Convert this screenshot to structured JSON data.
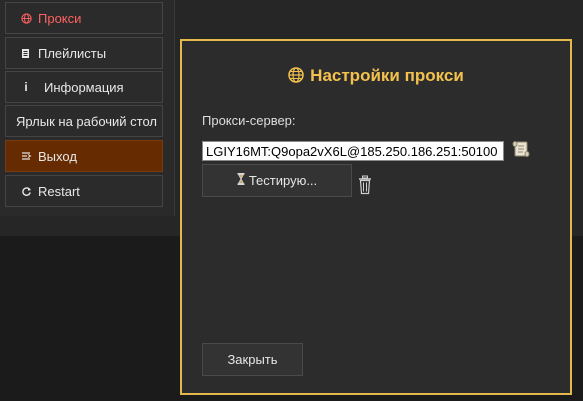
{
  "sidebar": {
    "items": [
      {
        "icon": "globe-icon",
        "label": "Прокси",
        "state": "active"
      },
      {
        "icon": "playlist-icon",
        "label": "Плейлисты"
      },
      {
        "icon": "info-icon",
        "label": "Информация"
      },
      {
        "icon": "",
        "label": "Ярлык на рабочий стол"
      },
      {
        "icon": "exit-icon",
        "label": "Выход",
        "state": "highlighted"
      },
      {
        "icon": "restart-icon",
        "label": "Restart"
      }
    ]
  },
  "dialog": {
    "title": "Настройки прокси",
    "title_icon": "globe-icon",
    "proxy_label": "Прокси-сервер:",
    "proxy_value": "LGIY16MT:Q9opa2vX6L@185.250.186.251:50100",
    "test_button": "Тестирую...",
    "close_button": "Закрыть"
  },
  "colors": {
    "accent": "#e4b84a",
    "title": "#f2c14e",
    "active_menu": "#ff6161",
    "exit_bg": "#662b00"
  }
}
